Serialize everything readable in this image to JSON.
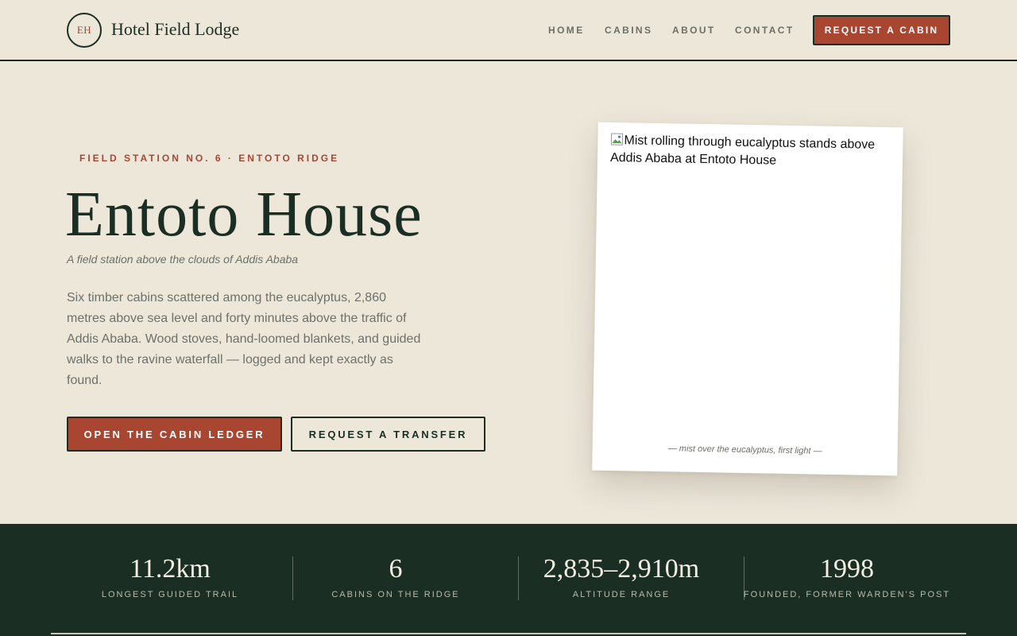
{
  "header": {
    "logo_initials": "EH",
    "brand_name": "Hotel Field Lodge",
    "nav": [
      {
        "label": "HOME"
      },
      {
        "label": "CABINS"
      },
      {
        "label": "ABOUT"
      },
      {
        "label": "CONTACT"
      }
    ],
    "cta_label": "REQUEST A CABIN"
  },
  "hero": {
    "eyebrow": "FIELD STATION NO. 6 · ENTOTO RIDGE",
    "title": "Entoto House",
    "subtitle": "A field station above the clouds of Addis Ababa",
    "body": "Six timber cabins scattered among the eucalyptus, 2,860 metres above sea level and forty minutes above the traffic of Addis Ababa. Wood stoves, hand-loomed blankets, and guided walks to the ravine waterfall — logged and kept exactly as found.",
    "primary_button": "OPEN THE CABIN LEDGER",
    "secondary_button": "REQUEST A TRANSFER"
  },
  "photo": {
    "alt_text": "Mist rolling through eucalyptus stands above Addis Ababa at Entoto House",
    "caption": "— mist over the eucalyptus, first light —",
    "icon": "broken-image-icon"
  },
  "stats": [
    {
      "value": "11.2km",
      "label": "LONGEST GUIDED TRAIL"
    },
    {
      "value": "6",
      "label": "CABINS ON THE RIDGE"
    },
    {
      "value": "2,835–2,910m",
      "label": "ALTITUDE RANGE"
    },
    {
      "value": "1998",
      "label": "FOUNDED, FORMER WARDEN'S POST"
    }
  ],
  "colors": {
    "background": "#ede7da",
    "ink": "#1b2e23",
    "accent": "#a84632",
    "muted": "#6b6f68"
  }
}
